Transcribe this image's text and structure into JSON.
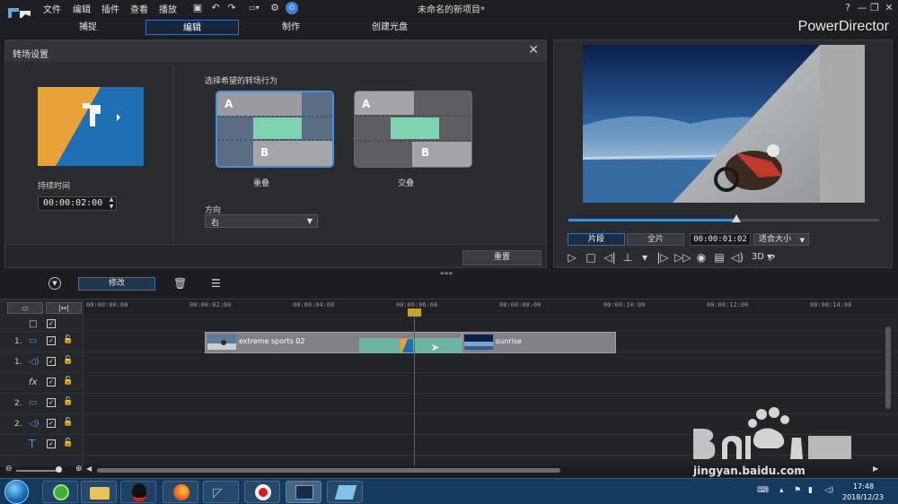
{
  "menu": {
    "file": "文件",
    "edit": "编辑",
    "plugins": "插件",
    "view": "查看",
    "play": "播放"
  },
  "window": {
    "title": "未命名的新项目*",
    "help": "?",
    "minimize": "—",
    "restore": "❐",
    "close": "✕"
  },
  "modes": {
    "capture": "捕捉",
    "edit": "编辑",
    "produce": "制作",
    "disc": "创建光盘"
  },
  "brand": "PowerDirector",
  "panel": {
    "title": "转场设置",
    "duration_label": "持续时间",
    "duration_value": "00:00:02:00",
    "behavior_label": "选择希望的转场行为",
    "overlap": {
      "label": "重叠",
      "a": "A",
      "b": "B"
    },
    "crossfade": {
      "label": "交叠",
      "a": "A",
      "b": "B"
    },
    "direction_label": "方向",
    "direction_value": "右",
    "reset_label": "重置"
  },
  "preview": {
    "clip_label": "片段",
    "movie_label": "全片",
    "time": "00:00:01:02",
    "fit_label": "适合大小",
    "threed_label": "3D",
    "progress": 0.54
  },
  "toolbar": {
    "modify_label": "修改"
  },
  "timeline": {
    "ruler": [
      "00:00:00:00",
      "00:00:02:00",
      "00:00:04:00",
      "00:00:06:00",
      "00:00:08:00",
      "00:00:10:00",
      "00:00:12:00",
      "00:00:14:00"
    ],
    "rows": [
      {
        "num": "1.",
        "icon": "video-track-icon"
      },
      {
        "num": "1.",
        "icon": "audio-track-icon"
      },
      {
        "num": "",
        "icon": "fx-track-icon"
      },
      {
        "num": "2.",
        "icon": "video-track-icon"
      },
      {
        "num": "2.",
        "icon": "audio-track-icon"
      },
      {
        "num": "",
        "icon": "title-track-icon"
      }
    ],
    "clip1_label": "extreme sports 02",
    "clip2_label": "sunrise"
  },
  "taskbar": {
    "time": "17:48",
    "date": "2018/12/23"
  },
  "watermark": {
    "url": "jingyan.baidu.com"
  },
  "colors": {
    "accent": "#3b6fae",
    "transition": "#6fb3a3",
    "playhead": "#d33030"
  }
}
